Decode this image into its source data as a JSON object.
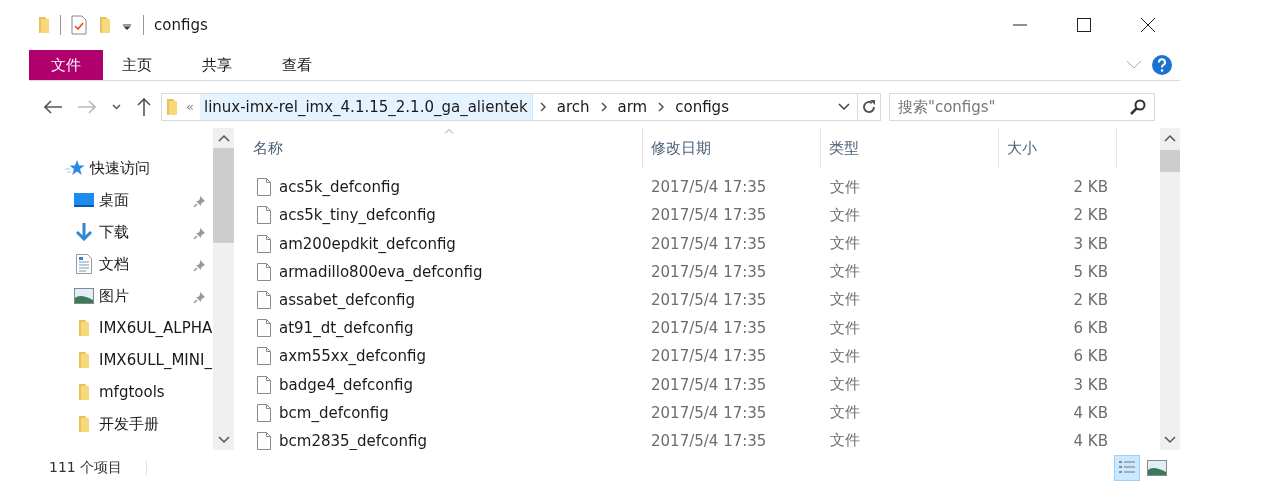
{
  "window": {
    "title": "configs"
  },
  "ribbon": {
    "tabs": [
      {
        "label": "文件",
        "kind": "file_menu"
      },
      {
        "label": "主页",
        "kind": "tab"
      },
      {
        "label": "共享",
        "kind": "tab"
      },
      {
        "label": "查看",
        "kind": "tab"
      }
    ]
  },
  "address_bar": {
    "overflow": "«",
    "crumbs": [
      {
        "label": "linux-imx-rel_imx_4.1.15_2.1.0_ga_alientek",
        "selected": true
      },
      {
        "label": "arch",
        "selected": false
      },
      {
        "label": "arm",
        "selected": false
      },
      {
        "label": "configs",
        "selected": false
      }
    ]
  },
  "search": {
    "placeholder": "搜索\"configs\""
  },
  "sidebar": {
    "items": [
      {
        "label": "快速访问",
        "kind": "quick_access",
        "pinned": false
      },
      {
        "label": "桌面",
        "kind": "desktop",
        "pinned": true
      },
      {
        "label": "下载",
        "kind": "download",
        "pinned": true
      },
      {
        "label": "文档",
        "kind": "documents",
        "pinned": true
      },
      {
        "label": "图片",
        "kind": "pictures",
        "pinned": true
      },
      {
        "label": "IMX6UL_ALPHA",
        "kind": "folder",
        "pinned": false
      },
      {
        "label": "IMX6ULL_MINI_",
        "kind": "folder",
        "pinned": false
      },
      {
        "label": "mfgtools",
        "kind": "folder",
        "pinned": false
      },
      {
        "label": "开发手册",
        "kind": "folder",
        "pinned": false
      }
    ]
  },
  "table": {
    "columns": [
      {
        "label": "名称",
        "sorted": true
      },
      {
        "label": "修改日期",
        "sorted": false
      },
      {
        "label": "类型",
        "sorted": false
      },
      {
        "label": "大小",
        "sorted": false
      }
    ],
    "rows": [
      [
        "acs5k_defconfig",
        "2017/5/4 17:35",
        "文件",
        "2 KB"
      ],
      [
        "acs5k_tiny_defconfig",
        "2017/5/4 17:35",
        "文件",
        "2 KB"
      ],
      [
        "am200epdkit_defconfig",
        "2017/5/4 17:35",
        "文件",
        "3 KB"
      ],
      [
        "armadillo800eva_defconfig",
        "2017/5/4 17:35",
        "文件",
        "5 KB"
      ],
      [
        "assabet_defconfig",
        "2017/5/4 17:35",
        "文件",
        "2 KB"
      ],
      [
        "at91_dt_defconfig",
        "2017/5/4 17:35",
        "文件",
        "6 KB"
      ],
      [
        "axm55xx_defconfig",
        "2017/5/4 17:35",
        "文件",
        "6 KB"
      ],
      [
        "badge4_defconfig",
        "2017/5/4 17:35",
        "文件",
        "3 KB"
      ],
      [
        "bcm_defconfig",
        "2017/5/4 17:35",
        "文件",
        "4 KB"
      ],
      [
        "bcm2835_defconfig",
        "2017/5/4 17:35",
        "文件",
        "4 KB"
      ]
    ]
  },
  "status_bar": {
    "item_count": "111 个项目",
    "views": [
      {
        "kind": "details",
        "selected": true
      },
      {
        "kind": "large_icons",
        "selected": false
      }
    ]
  }
}
